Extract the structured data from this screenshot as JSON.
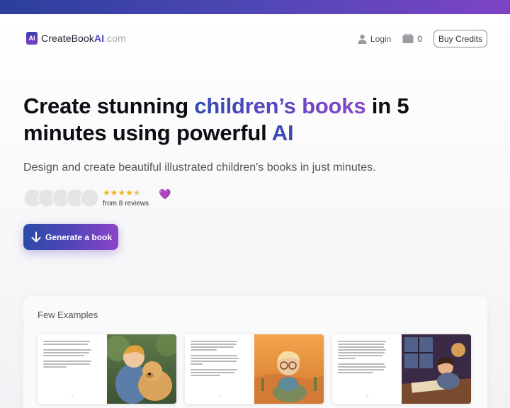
{
  "brand": {
    "mark": "AI",
    "name_prefix": "CreateBook",
    "name_ai": "AI",
    "name_tld": ".com"
  },
  "nav": {
    "login": "Login",
    "cart_count": "0",
    "buy_credits": "Buy Credits"
  },
  "hero": {
    "title_part1": "Create stunning ",
    "title_highlight": "children’s books",
    "title_part2": " in 5 minutes using powerful ",
    "title_ai": "AI",
    "subtitle": "Design and create beautiful illustrated children's books in just minutes.",
    "rating_value": 4.5,
    "stars": "★★★★★",
    "reviews_text": "from 8 reviews",
    "cta_label": "Generate a book"
  },
  "examples": {
    "title": "Few Examples",
    "books": [
      {
        "page_number": "1",
        "illustration": "boy-with-golden-retriever"
      },
      {
        "page_number": "4",
        "illustration": "child-with-glasses-in-desert"
      },
      {
        "page_number": "12",
        "illustration": "boy-reading-at-desk-by-window"
      }
    ]
  },
  "colors": {
    "accent_blue": "#2f4ab0",
    "accent_purple": "#8a45c9",
    "star": "#f2b622",
    "heart": "#7a34c8"
  },
  "icons": [
    "user-icon",
    "cart-icon",
    "star-icon",
    "heart-icon",
    "arrow-down-icon"
  ]
}
